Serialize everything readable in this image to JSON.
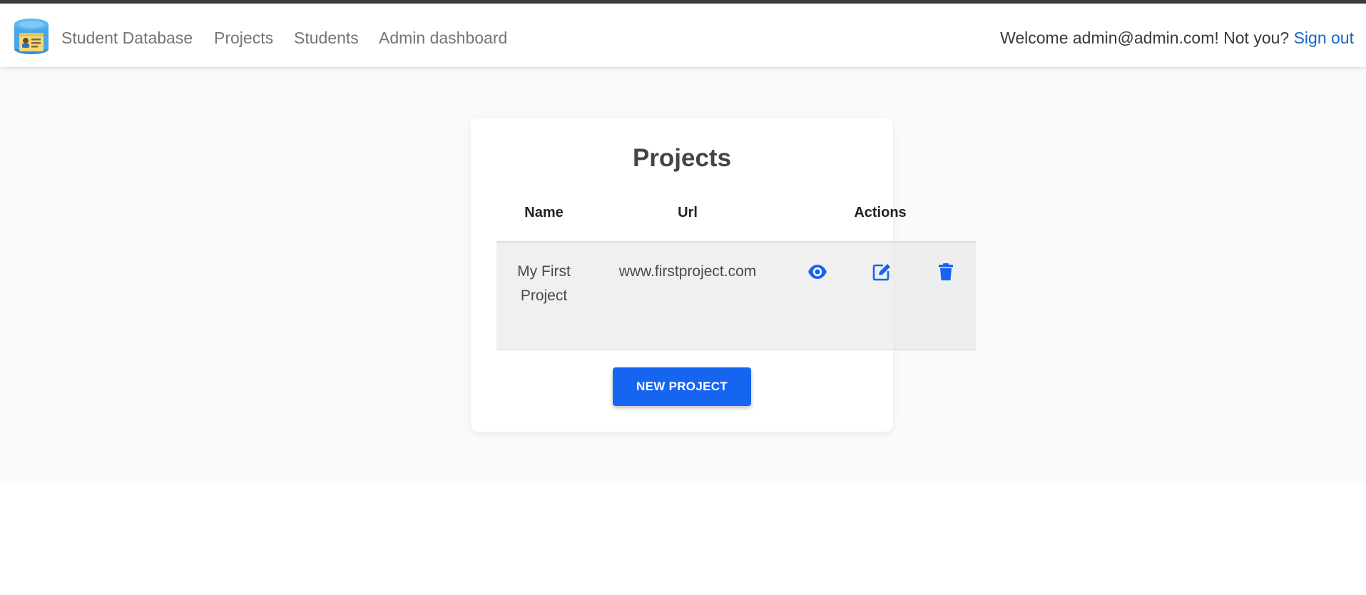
{
  "nav": {
    "brand": "Student Database",
    "links": [
      "Projects",
      "Students",
      "Admin dashboard"
    ],
    "welcome_text": "Welcome admin@admin.com! Not you?",
    "sign_out": "Sign out"
  },
  "projects": {
    "title": "Projects",
    "columns": [
      "Name",
      "Url",
      "Actions"
    ],
    "rows": [
      {
        "name": "My First Project",
        "url": "www.firstproject.com",
        "actions": [
          "eye-icon",
          "edit-icon",
          "trash-icon"
        ]
      }
    ],
    "new_button": "NEW PROJECT"
  },
  "colors": {
    "accent": "#1565f0",
    "link": "#1565c0",
    "nav_text": "#757575",
    "background": "#fafafa"
  }
}
